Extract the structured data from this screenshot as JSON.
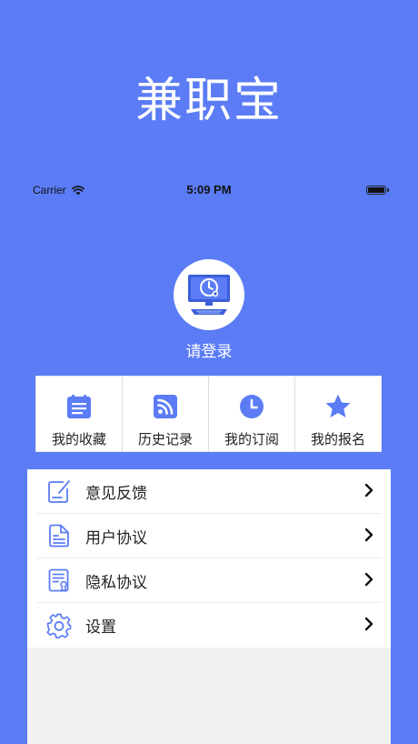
{
  "app": {
    "title": "兼职宝"
  },
  "status_bar": {
    "carrier": "Carrier",
    "time": "5:09 PM"
  },
  "profile": {
    "login_prompt": "请登录",
    "avatar_icon": "computer-clock-icon"
  },
  "quick_actions": [
    {
      "label": "我的收藏",
      "icon": "calendar-list-icon"
    },
    {
      "label": "历史记录",
      "icon": "rss-icon"
    },
    {
      "label": "我的订阅",
      "icon": "clock-icon"
    },
    {
      "label": "我的报名",
      "icon": "star-icon"
    }
  ],
  "menu": [
    {
      "label": "意见反馈",
      "icon": "feedback-edit-icon"
    },
    {
      "label": "用户协议",
      "icon": "document-icon"
    },
    {
      "label": "隐私协议",
      "icon": "certificate-icon"
    },
    {
      "label": "设置",
      "icon": "gear-icon"
    }
  ],
  "colors": {
    "background": "#5b7cf5",
    "accent": "#5b7cf5",
    "card": "#ffffff"
  }
}
